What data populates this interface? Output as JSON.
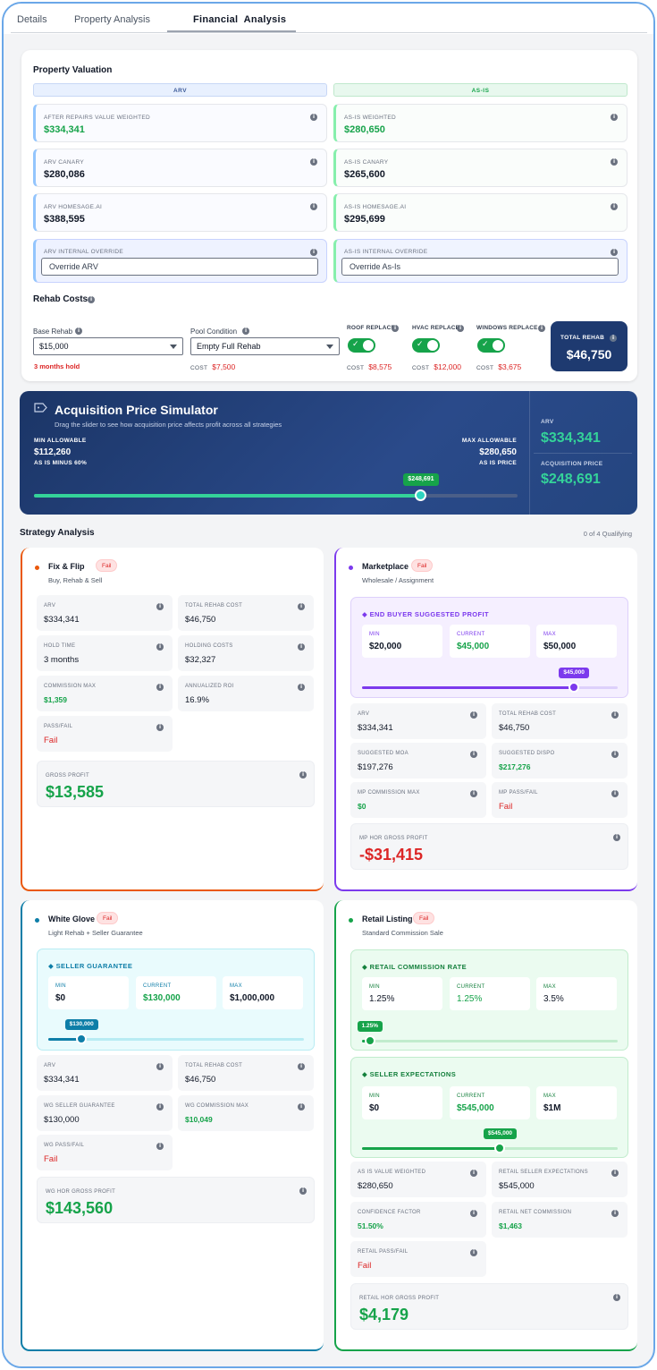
{
  "tabs": [
    {
      "label": "Details"
    },
    {
      "label": "Property Analysis"
    },
    {
      "label": "Financial  Analysis"
    }
  ],
  "valuation": {
    "title": "Property Valuation",
    "arv_header": "ARV",
    "asis_header": "AS-IS",
    "arv": [
      {
        "label": "AFTER REPAIRS VALUE WEIGHTED",
        "value": "$334,341"
      },
      {
        "label": "ARV CANARY",
        "value": "$280,086"
      },
      {
        "label": "ARV HOMESAGE.AI",
        "value": "$388,595"
      }
    ],
    "asis": [
      {
        "label": "AS-IS WEIGHTED",
        "value": "$280,650"
      },
      {
        "label": "AS-IS CANARY",
        "value": "$265,600"
      },
      {
        "label": "AS-IS HOMESAGE.AI",
        "value": "$295,699"
      }
    ],
    "arv_override": {
      "label": "ARV INTERNAL OVERRIDE",
      "placeholder": "Override ARV"
    },
    "asis_override": {
      "label": "AS-IS INTERNAL OVERRIDE",
      "placeholder": "Override As-Is"
    }
  },
  "rehab": {
    "title": "Rehab Costs",
    "base": {
      "label": "Base Rehab",
      "value": "$15,000",
      "note": "3 months hold"
    },
    "pool": {
      "label": "Pool Condition",
      "value": "Empty Full Rehab",
      "cost_label": "COST",
      "cost": "$7,500"
    },
    "replacements": [
      {
        "label": "ROOF REPLACE",
        "cost_label": "COST",
        "cost": "$8,575"
      },
      {
        "label": "HVAC REPLACE",
        "cost_label": "COST",
        "cost": "$12,000"
      },
      {
        "label": "WINDOWS REPLACE",
        "cost_label": "COST",
        "cost": "$3,675"
      }
    ],
    "total": {
      "label": "TOTAL REHAB",
      "value": "$46,750"
    }
  },
  "simulator": {
    "title": "Acquisition Price Simulator",
    "subtitle": "Drag the slider to see how acquisition price affects profit across all strategies",
    "min_label": "MIN ALLOWABLE",
    "min_value": "$112,260",
    "min_note": "AS IS MINUS 60%",
    "max_label": "MAX ALLOWABLE",
    "max_value": "$280,650",
    "max_note": "AS IS PRICE",
    "slider_value": "$248,691",
    "slider_fraction": 0.8,
    "arv_label": "ARV",
    "arv_value": "$334,341",
    "acq_label": "ACQUISITION PRICE",
    "acq_value": "$248,691"
  },
  "strategy": {
    "title": "Strategy Analysis",
    "qualifying": "0 of 4 Qualifying",
    "fix_flip": {
      "name": "Fix & Flip",
      "status": "Fail",
      "desc": "Buy, Rehab & Sell",
      "color": "#ea580c",
      "metrics": [
        {
          "label": "ARV",
          "value": "$334,341"
        },
        {
          "label": "TOTAL REHAB COST",
          "value": "$46,750"
        },
        {
          "label": "HOLD TIME",
          "value": "3 months"
        },
        {
          "label": "HOLDING COSTS",
          "value": "$32,327"
        },
        {
          "label": "COMMISSION MAX",
          "value": "$1,359"
        },
        {
          "label": "ANNUALIZED ROI",
          "value": "16.9%"
        },
        {
          "label": "PASS/FAIL",
          "value": "Fail"
        }
      ],
      "gross_label": "GROSS PROFIT",
      "gross_value": "$13,585"
    },
    "marketplace": {
      "name": "Marketplace",
      "status": "Fail",
      "desc": "Wholesale / Assignment",
      "color": "#7c3aed",
      "panel": {
        "title": "END BUYER SUGGESTED PROFIT",
        "min_label": "MIN",
        "min": "$20,000",
        "cur_label": "CURRENT",
        "cur": "$45,000",
        "max_label": "MAX",
        "max": "$50,000",
        "slider_value": "$45,000",
        "fraction": 0.83
      },
      "metrics": [
        {
          "label": "ARV",
          "value": "$334,341"
        },
        {
          "label": "TOTAL REHAB COST",
          "value": "$46,750"
        },
        {
          "label": "SUGGESTED MOA",
          "value": "$197,276"
        },
        {
          "label": "SUGGESTED DISPO",
          "value": "$217,276"
        },
        {
          "label": "MP COMMISSION MAX",
          "value": "$0"
        },
        {
          "label": "MP PASS/FAIL",
          "value": "Fail"
        }
      ],
      "gross_label": "MP HOR GROSS PROFIT",
      "gross_value": "-$31,415"
    },
    "white_glove": {
      "name": "White Glove",
      "status": "Fail",
      "desc": "Light Rehab + Seller Guarantee",
      "color": "#0e7ea8",
      "panel": {
        "title": "SELLER GUARANTEE",
        "min_label": "MIN",
        "min": "$0",
        "cur_label": "CURRENT",
        "cur": "$130,000",
        "max_label": "MAX",
        "max": "$1,000,000",
        "slider_value": "$130,000",
        "fraction": 0.13
      },
      "metrics": [
        {
          "label": "ARV",
          "value": "$334,341"
        },
        {
          "label": "TOTAL REHAB COST",
          "value": "$46,750"
        },
        {
          "label": "WG SELLER GUARANTEE",
          "value": "$130,000"
        },
        {
          "label": "WG COMMISSION MAX",
          "value": "$10,049"
        },
        {
          "label": "WG PASS/FAIL",
          "value": "Fail"
        }
      ],
      "gross_label": "WG HOR GROSS PROFIT",
      "gross_value": "$143,560"
    },
    "retail": {
      "name": "Retail Listing",
      "status": "Fail",
      "desc": "Standard Commission Sale",
      "color": "#16a34a",
      "panel1": {
        "title": "RETAIL COMMISSION RATE",
        "min_label": "MIN",
        "min": "1.25%",
        "cur_label": "CURRENT",
        "cur": "1.25%",
        "max_label": "MAX",
        "max": "3.5%",
        "slider_value": "1.25%",
        "fraction": 0.03
      },
      "panel2": {
        "title": "SELLER EXPECTATIONS",
        "min_label": "MIN",
        "min": "$0",
        "cur_label": "CURRENT",
        "cur": "$545,000",
        "max_label": "MAX",
        "max": "$1M",
        "slider_value": "$545,000",
        "fraction": 0.54
      },
      "metrics": [
        {
          "label": "AS IS VALUE WEIGHTED",
          "value": "$280,650"
        },
        {
          "label": "RETAIL SELLER EXPECTATIONS",
          "value": "$545,000"
        },
        {
          "label": "CONFIDENCE FACTOR",
          "value": "51.50%"
        },
        {
          "label": "RETAIL NET COMMISSION",
          "value": "$1,463"
        },
        {
          "label": "RETAIL PASS/FAIL",
          "value": "Fail"
        }
      ],
      "gross_label": "RETAIL HOR GROSS PROFIT",
      "gross_value": "$4,179"
    }
  },
  "colors": {
    "green": "#16a34a",
    "red": "#dc2626",
    "navy": "#1e3a70"
  }
}
